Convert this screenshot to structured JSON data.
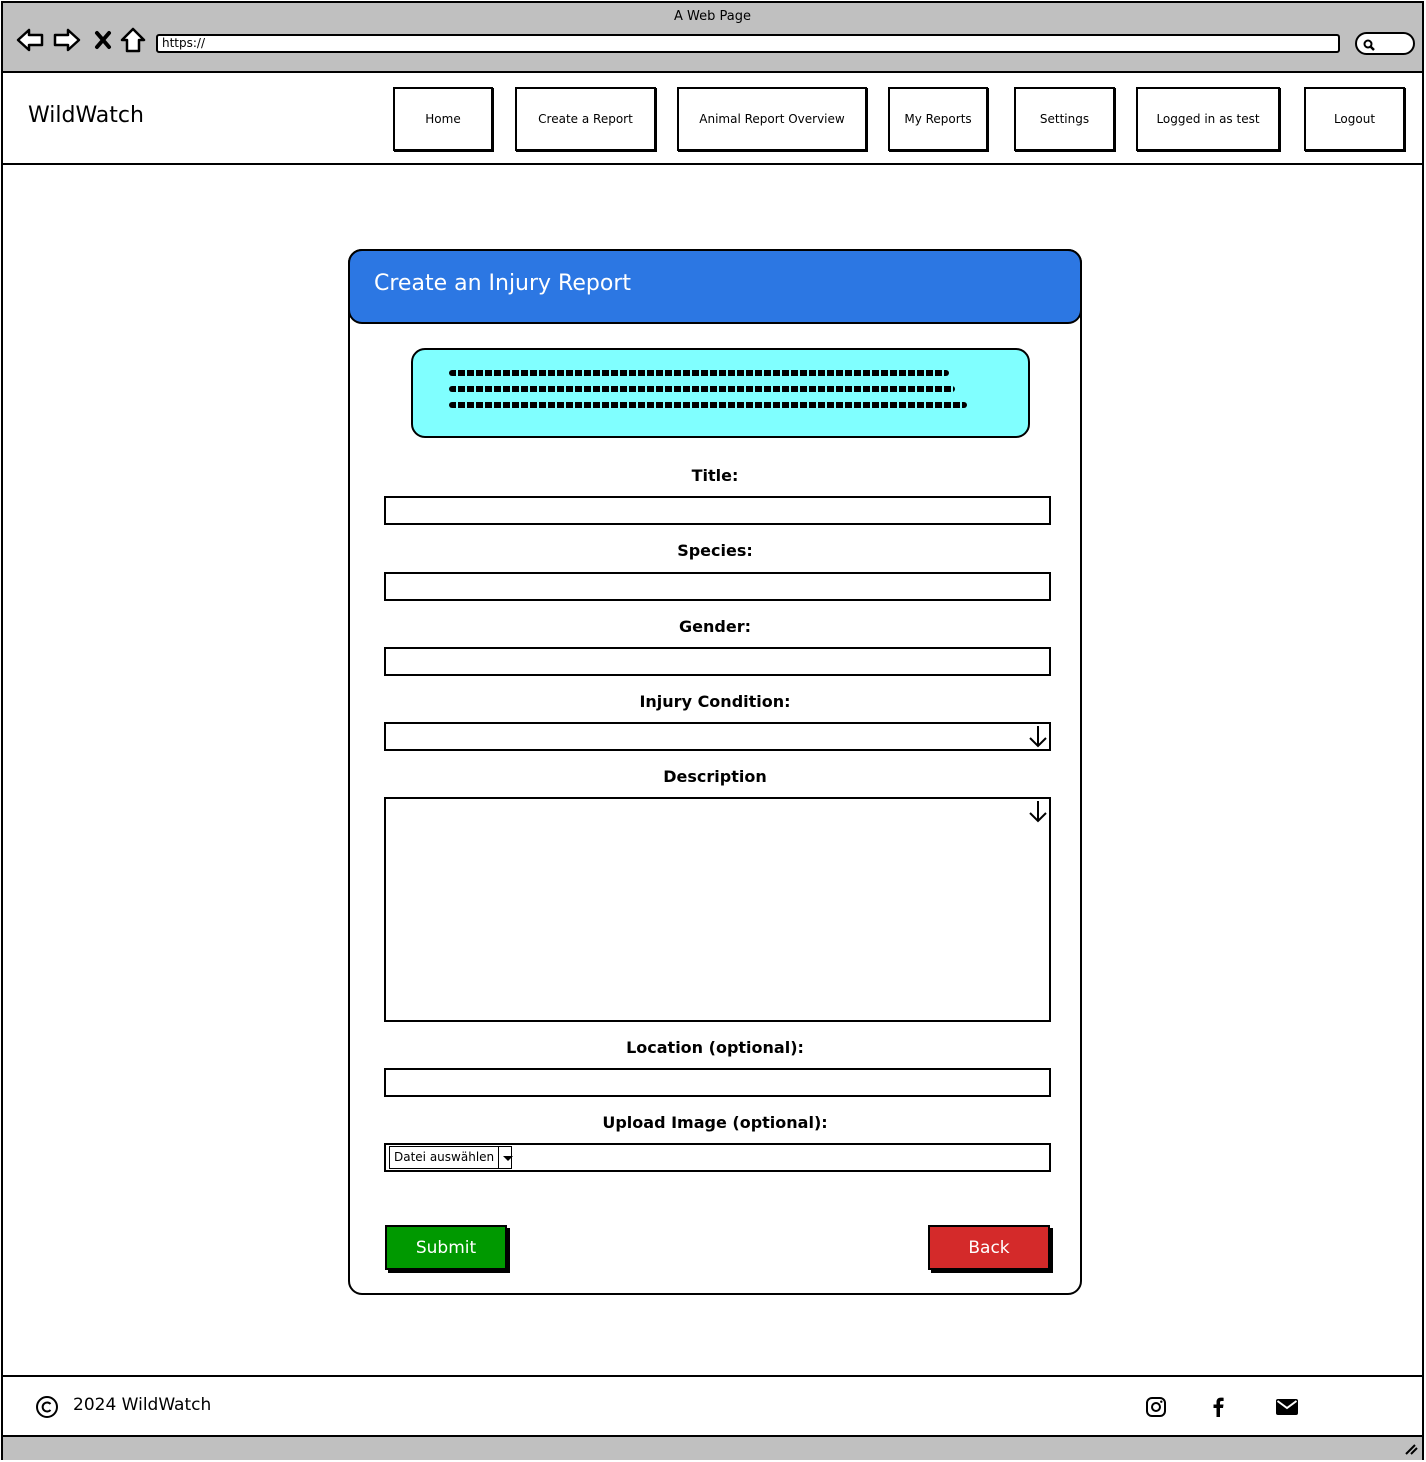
{
  "browser": {
    "window_title": "A Web Page",
    "url": "https://"
  },
  "header": {
    "brand": "WildWatch",
    "nav": [
      {
        "label": "Home"
      },
      {
        "label": "Create a Report"
      },
      {
        "label": "Animal Report Overview"
      },
      {
        "label": "My Reports"
      },
      {
        "label": "Settings"
      },
      {
        "label": "Logged in as test"
      },
      {
        "label": "Logout"
      }
    ]
  },
  "form": {
    "title": "Create an Injury Report",
    "info_box_color": "#80ffff",
    "header_color": "#2c77e3",
    "fields": {
      "title_label": "Title:",
      "species_label": "Species:",
      "gender_label": "Gender:",
      "injury_label": "Injury Condition:",
      "description_label": "Description",
      "location_label": "Location (optional):",
      "upload_label": "Upload Image (optional):",
      "file_button": "Datei auswählen"
    },
    "buttons": {
      "submit": "Submit",
      "submit_color": "#009900",
      "back": "Back",
      "back_color": "#d42a2a"
    }
  },
  "footer": {
    "copyright": "2024 WildWatch",
    "icons": [
      "copyright-icon",
      "instagram-icon",
      "facebook-icon",
      "mail-icon"
    ]
  }
}
